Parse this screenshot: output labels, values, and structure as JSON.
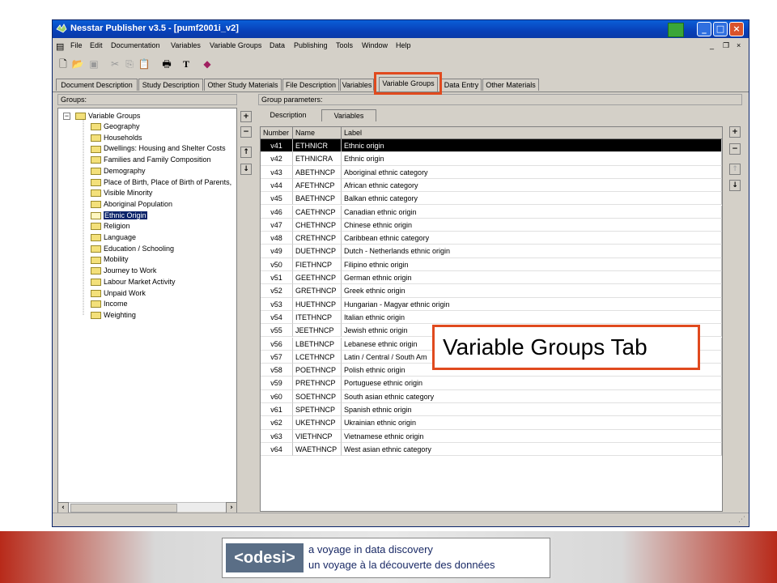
{
  "window": {
    "title": "Nesstar Publisher v3.5 - [pumf2001i_v2]"
  },
  "menu": [
    "File",
    "Edit",
    "Documentation",
    "Variables",
    "Variable Groups",
    "Data",
    "Publishing",
    "Tools",
    "Window",
    "Help"
  ],
  "tabs": [
    "Document Description",
    "Study Description",
    "Other Study Materials",
    "File Description",
    "Variables",
    "Variable Groups",
    "Data Entry",
    "Other Materials"
  ],
  "active_tab": "Variable Groups",
  "groups_panel": {
    "label": "Groups:",
    "root": "Variable Groups",
    "items": [
      "Geography",
      "Households",
      "Dwellings: Housing and Shelter Costs",
      "Families and Family Composition",
      "Demography",
      "Place of Birth, Place of Birth of Parents,",
      "Visible Minority",
      "Aboriginal Population",
      "Ethnic Origin",
      "Religion",
      "Language",
      "Education / Schooling",
      "Mobility",
      "Journey to Work",
      "Labour Market Activity",
      "Unpaid Work",
      "Income",
      "Weighting"
    ],
    "selected": "Ethnic Origin"
  },
  "params_panel": {
    "label": "Group parameters:",
    "subtabs": [
      "Description",
      "Variables"
    ],
    "columns": [
      "Number",
      "Name",
      "Label"
    ],
    "rows": [
      [
        "v41",
        "ETHNICR",
        "Ethnic origin"
      ],
      [
        "v42",
        "ETHNICRA",
        "Ethnic origin"
      ],
      [
        "v43",
        "ABETHNCP",
        "Aboriginal ethnic category"
      ],
      [
        "v44",
        "AFETHNCP",
        "African ethnic category"
      ],
      [
        "v45",
        "BAETHNCP",
        "Balkan ethnic category"
      ],
      [
        "v46",
        "CAETHNCP",
        "Canadian ethnic origin"
      ],
      [
        "v47",
        "CHETHNCP",
        "Chinese ethnic origin"
      ],
      [
        "v48",
        "CRETHNCP",
        "Caribbean ethnic category"
      ],
      [
        "v49",
        "DUETHNCP",
        "Dutch - Netherlands ethnic origin"
      ],
      [
        "v50",
        "FIETHNCP",
        "Filipino ethnic origin"
      ],
      [
        "v51",
        "GEETHNCP",
        "German ethnic origin"
      ],
      [
        "v52",
        "GRETHNCP",
        "Greek ethnic origin"
      ],
      [
        "v53",
        "HUETHNCP",
        "Hungarian - Magyar ethnic origin"
      ],
      [
        "v54",
        "ITETHNCP",
        "Italian ethnic origin"
      ],
      [
        "v55",
        "JEETHNCP",
        "Jewish ethnic origin"
      ],
      [
        "v56",
        "LBETHNCP",
        "Lebanese ethnic origin"
      ],
      [
        "v57",
        "LCETHNCP",
        "Latin / Central / South Am"
      ],
      [
        "v58",
        "POETHNCP",
        "Polish ethnic origin"
      ],
      [
        "v59",
        "PRETHNCP",
        "Portuguese ethnic origin"
      ],
      [
        "v60",
        "SOETHNCP",
        "South asian ethnic category"
      ],
      [
        "v61",
        "SPETHNCP",
        "Spanish ethnic origin"
      ],
      [
        "v62",
        "UKETHNCP",
        "Ukrainian ethnic origin"
      ],
      [
        "v63",
        "VIETHNCP",
        "Vietnamese ethnic origin"
      ],
      [
        "v64",
        "WAETHNCP",
        "West asian ethnic category"
      ]
    ],
    "selected_row": 0
  },
  "callout": "Variable Groups Tab",
  "footer": {
    "logo": "<odesi>",
    "line1": "a voyage in data discovery",
    "line2": "un voyage à la découverte des données"
  },
  "colors": {
    "highlight": "#e04a1e",
    "titlebar": "#0a5fd8",
    "selection": "#0a246a"
  }
}
